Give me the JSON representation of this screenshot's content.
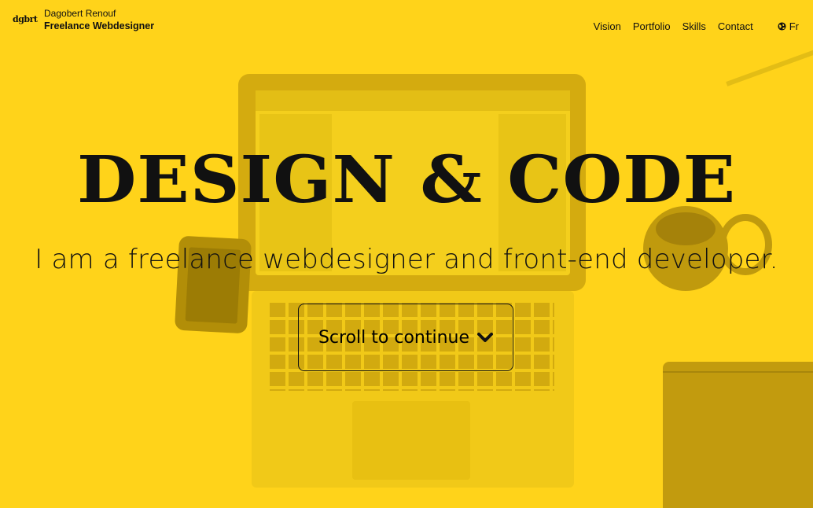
{
  "header": {
    "logo_text": "dgbrt",
    "name": "Dagobert Renouf",
    "title": "Freelance Webdesigner",
    "nav": [
      "Vision",
      "Portfolio",
      "Skills",
      "Contact"
    ],
    "language": "Fr",
    "language_icon": "globe-icon"
  },
  "hero": {
    "title": "DESIGN & CODE",
    "subtitle": "I am a freelance webdesigner and front-end developer.",
    "scroll_label": "Scroll to continue",
    "scroll_icon": "chevron-down-icon"
  },
  "colors": {
    "background": "#ffd31a",
    "text": "#111111"
  }
}
